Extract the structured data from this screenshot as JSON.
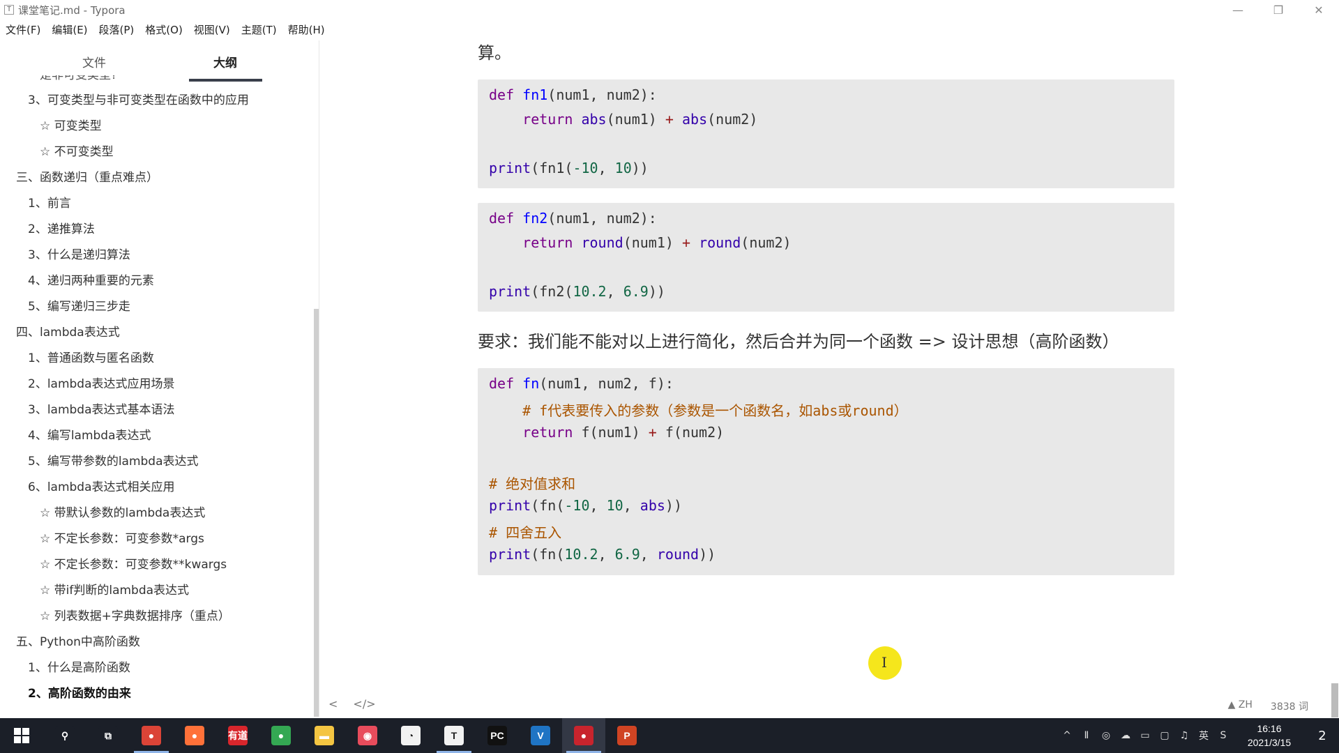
{
  "window": {
    "app_icon": "T",
    "title": "课堂笔记.md - Typora",
    "minimize": "—",
    "restore": "❐",
    "close": "✕"
  },
  "menu": [
    "文件(F)",
    "编辑(E)",
    "段落(P)",
    "格式(O)",
    "视图(V)",
    "主题(T)",
    "帮助(H)"
  ],
  "sidebar": {
    "tab_files": "文件",
    "tab_outline": "大纲",
    "items": [
      {
        "label": "是非可变类型?",
        "level": 4,
        "cut": true
      },
      {
        "label": "3、可变类型与非可变类型在函数中的应用",
        "level": 3
      },
      {
        "label": "☆ 可变类型",
        "level": 4
      },
      {
        "label": "☆ 不可变类型",
        "level": 4
      },
      {
        "label": "三、函数递归（重点难点）",
        "level": 2
      },
      {
        "label": "1、前言",
        "level": 3
      },
      {
        "label": "2、递推算法",
        "level": 3
      },
      {
        "label": "3、什么是递归算法",
        "level": 3
      },
      {
        "label": "4、递归两种重要的元素",
        "level": 3
      },
      {
        "label": "5、编写递归三步走",
        "level": 3
      },
      {
        "label": "四、lambda表达式",
        "level": 2
      },
      {
        "label": "1、普通函数与匿名函数",
        "level": 3
      },
      {
        "label": "2、lambda表达式应用场景",
        "level": 3
      },
      {
        "label": "3、lambda表达式基本语法",
        "level": 3
      },
      {
        "label": "4、编写lambda表达式",
        "level": 3
      },
      {
        "label": "5、编写带参数的lambda表达式",
        "level": 3
      },
      {
        "label": "6、lambda表达式相关应用",
        "level": 3
      },
      {
        "label": "☆ 带默认参数的lambda表达式",
        "level": 4
      },
      {
        "label": "☆ 不定长参数：可变参数*args",
        "level": 4
      },
      {
        "label": "☆ 不定长参数：可变参数**kwargs",
        "level": 4
      },
      {
        "label": "☆ 带if判断的lambda表达式",
        "level": 4
      },
      {
        "label": "☆ 列表数据+字典数据排序（重点）",
        "level": 4
      },
      {
        "label": "五、Python中高阶函数",
        "level": 2
      },
      {
        "label": "1、什么是高阶函数",
        "level": 3
      },
      {
        "label": "2、高阶函数的由来",
        "level": 3,
        "active": true
      }
    ]
  },
  "editor": {
    "para_top": "算。",
    "para_mid": "要求：我们能不能对以上进行简化，然后合并为同一个函数 => 设计思想（高阶函数）",
    "code1": {
      "l1_kw": "def",
      "l1_fn": "fn1",
      "l1_rest": "(num1, num2):",
      "l2_kw": "return",
      "l2_b1": "abs",
      "l2_a1": "(num1) ",
      "l2_op": "+",
      "l2_b2": "abs",
      "l2_a2": "(num2)",
      "l3_b": "print",
      "l3_a": "(fn1(",
      "l3_n1": "-10",
      "l3_c": ", ",
      "l3_n2": "10",
      "l3_e": "))"
    },
    "code2": {
      "l1_kw": "def",
      "l1_fn": "fn2",
      "l1_rest": "(num1, num2):",
      "l2_kw": "return",
      "l2_b1": "round",
      "l2_a1": "(num1) ",
      "l2_op": "+",
      "l2_b2": "round",
      "l2_a2": "(num2)",
      "l3_b": "print",
      "l3_a": "(fn2(",
      "l3_n1": "10.2",
      "l3_c": ", ",
      "l3_n2": "6.9",
      "l3_e": "))"
    },
    "code3": {
      "l1_kw": "def",
      "l1_fn": "fn",
      "l1_rest": "(num1, num2, f):",
      "l2_cm": "# f代表要传入的参数（参数是一个函数名，如abs或round）",
      "l3_kw": "return",
      "l3_a": " f(num1) ",
      "l3_op": "+",
      "l3_b": " f(num2)",
      "l4_cm": "# 绝对值求和",
      "l5_b": "print",
      "l5_a": "(fn(",
      "l5_n1": "-10",
      "l5_c1": ", ",
      "l5_n2": "10",
      "l5_c2": ", ",
      "l5_f": "abs",
      "l5_e": "))",
      "l6_cm": "# 四舍五入",
      "l7_b": "print",
      "l7_a": "(fn(",
      "l7_n1": "10.2",
      "l7_c1": ", ",
      "l7_n2": "6.9",
      "l7_c2": ", ",
      "l7_f": "round",
      "l7_e": "))"
    },
    "cursor": "I"
  },
  "statusbar": {
    "back": "<",
    "source_toggle": "</>",
    "lang": "▲ ZH",
    "word_count": "3838 词"
  },
  "taskbar": {
    "start_icon": "windows-start-icon",
    "apps": [
      {
        "name": "search-icon",
        "label": "⚲",
        "color": "#1b1f28"
      },
      {
        "name": "task-view-icon",
        "label": "⧉",
        "color": "#1b1f28"
      },
      {
        "name": "chrome-icon",
        "label": "●",
        "color": "#db4437",
        "active": true
      },
      {
        "name": "firefox-icon",
        "label": "●",
        "color": "#ff7139"
      },
      {
        "name": "youdao-icon",
        "label": "有道",
        "color": "#d8262c"
      },
      {
        "name": "chrome-alt-icon",
        "label": "●",
        "color": "#34a853"
      },
      {
        "name": "file-explorer-icon",
        "label": "▬",
        "color": "#f4c542"
      },
      {
        "name": "recorder-icon",
        "label": "◉",
        "color": "#e84c5c"
      },
      {
        "name": "clock-app-icon",
        "label": "◔",
        "color": "#f2f2f2"
      },
      {
        "name": "typora-icon",
        "label": "T",
        "color": "#f2f2f2",
        "active": true
      },
      {
        "name": "pycharm-icon",
        "label": "PC",
        "color": "#111111"
      },
      {
        "name": "vscode-icon",
        "label": "V",
        "color": "#1f74c4"
      },
      {
        "name": "screen-record-icon",
        "label": "●",
        "color": "#c8242d",
        "active": true,
        "pressed": true
      },
      {
        "name": "powerpoint-icon",
        "label": "P",
        "color": "#d04423"
      }
    ],
    "tray": [
      "^",
      "Ⅱ",
      "◎",
      "☁",
      "▭",
      "▢",
      "♫",
      "英",
      "S"
    ],
    "time": "16:16",
    "date": "2021/3/15",
    "notifications": "2"
  }
}
